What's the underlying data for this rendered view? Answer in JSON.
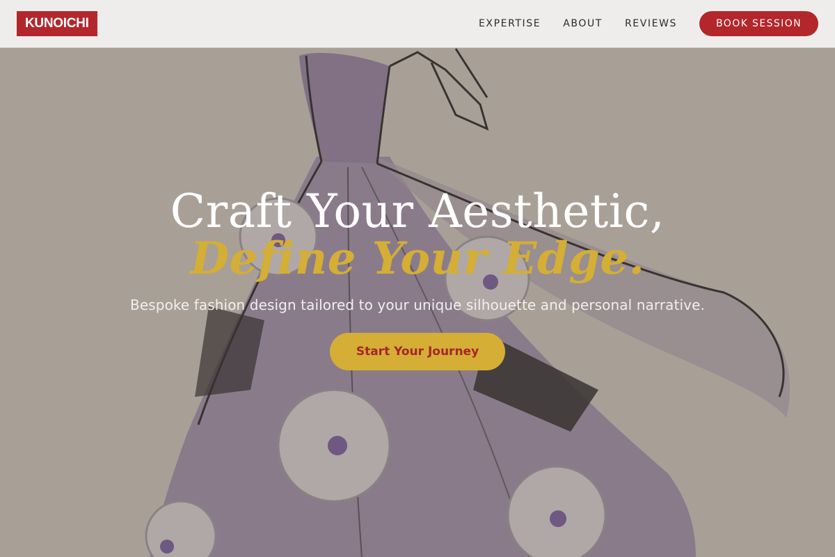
{
  "brand": {
    "logo_text": "KUNOICHI"
  },
  "nav": {
    "links": [
      "EXPERTISE",
      "ABOUT",
      "REVIEWS"
    ],
    "cta_label": "BOOK SESSION"
  },
  "hero": {
    "headline_line1": "Craft Your Aesthetic,",
    "headline_line2": "Define Your Edge.",
    "subtitle": "Bespoke fashion design tailored to your unique silhouette and personal narrative.",
    "cta_label": "Start Your Journey",
    "background_image": "fashion-sketch-gown"
  },
  "colors": {
    "brand_red": "#b3262b",
    "accent_gold": "#d4ae35",
    "nav_bg": "#f4f3f1"
  }
}
